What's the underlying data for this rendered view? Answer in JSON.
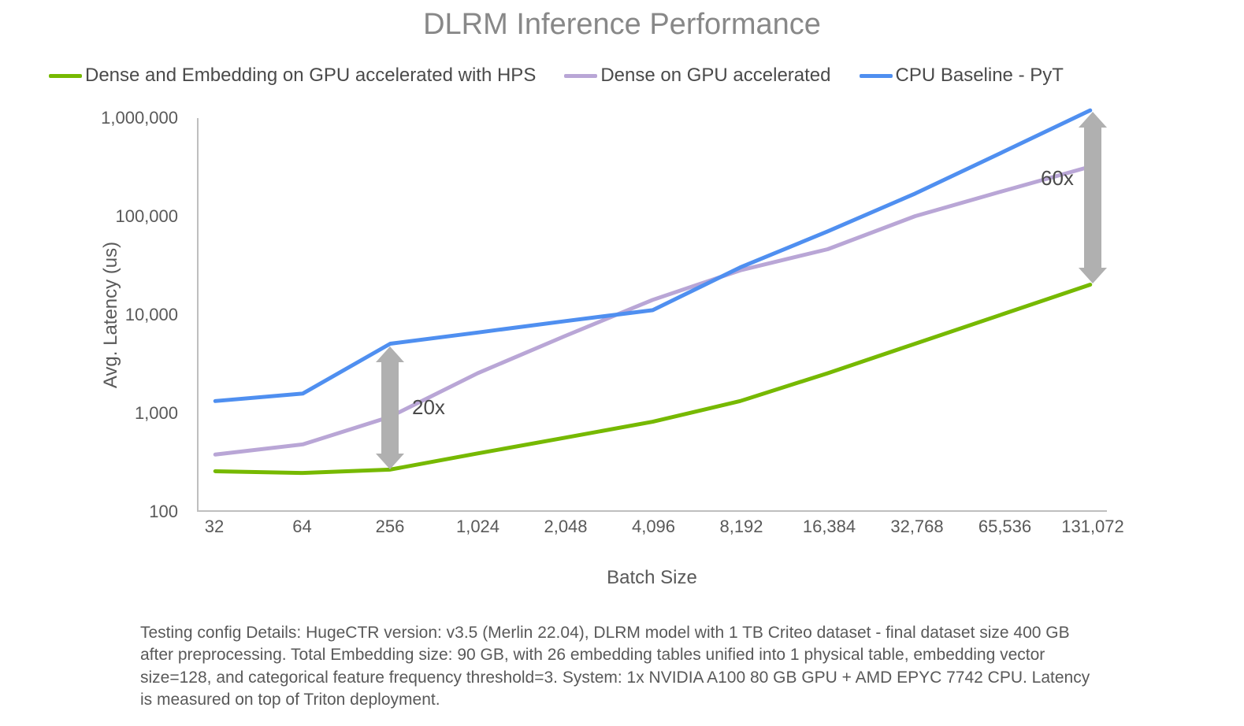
{
  "chart_data": {
    "type": "line",
    "title": "DLRM Inference Performance",
    "xlabel": "Batch Size",
    "ylabel": "Avg. Latency (us)",
    "x_categories": [
      "32",
      "64",
      "256",
      "1,024",
      "2,048",
      "4,096",
      "8,192",
      "16,384",
      "32,768",
      "65,536",
      "131,072"
    ],
    "y_ticks": [
      "100",
      "1,000",
      "10,000",
      "100,000",
      "1,000,000"
    ],
    "y_scale": "log10",
    "ylim": [
      100,
      1000000
    ],
    "series": [
      {
        "name": "Dense and Embedding on GPU accelerated with HPS",
        "color": "#76b900",
        "values": [
          250,
          240,
          260,
          380,
          550,
          800,
          1300,
          2500,
          5000,
          10000,
          20000
        ]
      },
      {
        "name": "Dense on GPU accelerated",
        "color": "#b9a6d6",
        "values": [
          370,
          470,
          900,
          2500,
          6000,
          14000,
          28000,
          46000,
          100000,
          180000,
          320000
        ]
      },
      {
        "name": "CPU Baseline - PyT",
        "color": "#4f8ff0",
        "values": [
          1300,
          1550,
          5000,
          6500,
          8500,
          11000,
          30000,
          70000,
          170000,
          450000,
          1200000
        ]
      }
    ],
    "annotations": [
      {
        "label": "20x",
        "x_index": 2,
        "between_series": [
          0,
          2
        ]
      },
      {
        "label": "60x",
        "x_index": 10,
        "between_series": [
          0,
          2
        ]
      }
    ],
    "legend_position": "top-left",
    "footnote": "Testing config Details: HugeCTR version: v3.5 (Merlin 22.04), DLRM model with 1 TB Criteo dataset - final dataset size 400 GB after preprocessing. Total Embedding size: 90 GB, with 26 embedding tables unified into 1 physical table, embedding vector size=128, and categorical feature frequency threshold=3. System: 1x NVIDIA A100 80 GB GPU + AMD EPYC 7742 CPU. Latency is measured on top of Triton deployment."
  }
}
